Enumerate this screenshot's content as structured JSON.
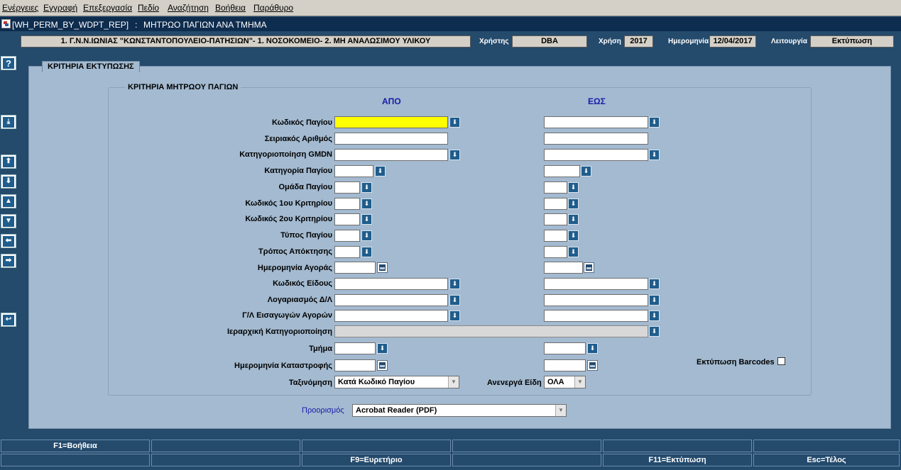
{
  "menu": {
    "items": [
      "Ενέργειες",
      "Εγγραφή",
      "Επεξεργασία",
      "Πεδίο",
      "Αναζήτηση",
      "Βοήθεια",
      "Παράθυρο"
    ]
  },
  "window": {
    "title_code": "[WH_PERM_BY_WDPT_REP]",
    "title_sep": ":",
    "title_name": "ΜΗΤΡΩΟ ΠΑΓΙΩΝ ΑΝΑ ΤΜΗΜΑ"
  },
  "infobar": {
    "organization": "1. Γ.Ν.Ν.ΙΩΝΙΑΣ \"ΚΩΝΣΤΑΝΤΟΠΟΥΛΕΙΟ-ΠΑΤΗΣΙΩΝ\"- 1. ΝΟΣΟΚΟΜΕΙΟ- 2. ΜΗ ΑΝΑΛΩΣΙΜΟΥ ΥΛΙΚΟΥ",
    "user_label": "Χρήστης",
    "user_value": "DBA",
    "year_label": "Χρήση",
    "year_value": "2017",
    "date_label": "Ημερομηνία",
    "date_value": "12/04/2017",
    "mode_label": "Λειτουργία",
    "mode_value": "Εκτύπωση"
  },
  "sidebar": {
    "icons": [
      "help-icon",
      "download-icon",
      "first-record-icon",
      "last-record-icon",
      "previous-record-icon",
      "next-record-icon",
      "previous-block-icon",
      "next-block-icon",
      "return-icon"
    ],
    "help_glyph": "?"
  },
  "form": {
    "tab_label": "ΚΡΙΤΗΡΙΑ ΕΚΤΥΠΩΣΗΣ",
    "group_label": "ΚΡΙΤΗΡΙΑ ΜΗΤΡΩΟΥ ΠΑΓΙΩΝ",
    "col_from": "ΑΠΟ",
    "col_to": "ΕΩΣ",
    "labels": {
      "asset_code": "Κωδικός Παγίου",
      "serial_number": "Σειριακός Αριθμός",
      "gmdn": "Κατηγοριοποίηση GMDN",
      "asset_category": "Κατηγορία Παγίου",
      "asset_group": "Ομάδα Παγίου",
      "criterion1": "Κωδικός 1ου Κριτηρίου",
      "criterion2": "Κωδικός 2ου Κριτηρίου",
      "asset_type": "Τύπος Παγίου",
      "acquisition": "Τρόπος Απόκτησης",
      "purchase_date": "Ημερομηνία Αγοράς",
      "item_code": "Κωδικός Είδους",
      "gl_account": "Λογαριασμός Δ/Λ",
      "gl_imports": "Γ/Λ Εισαγωγών Αγορών",
      "hierarchy": "Ιεραρχική Κατηγοριοποίηση",
      "department": "Τμήμα",
      "destruction_date": "Ημερομηνία Καταστροφής",
      "sorting": "Ταξινόμηση",
      "inactive": "Ανενεργά Είδη",
      "print_barcodes": "Εκτύπωση Barcodes",
      "destination": "Προορισμός"
    },
    "sorting_value": "Κατά Κωδικό Παγίου",
    "inactive_value": "ΟΛΑ",
    "destination_value": "Acrobat Reader (PDF)",
    "barcodes_checked": false
  },
  "fkeys": {
    "row1": [
      "F1=Βοήθεια",
      "",
      "",
      "",
      "",
      ""
    ],
    "row2": [
      "",
      "",
      "F9=Ευρετήριο",
      "",
      "F11=Εκτύπωση",
      "Esc=Τέλος"
    ]
  },
  "colors": {
    "background": "#244a6c",
    "panel": "#a3bad0",
    "required_field": "#ffff00",
    "column_header": "#1a1aa8"
  }
}
